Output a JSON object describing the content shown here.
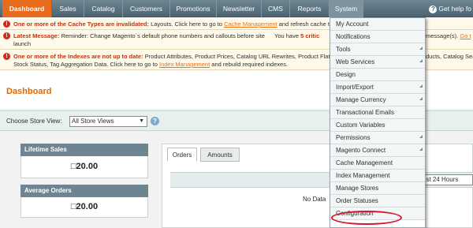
{
  "nav": {
    "items": [
      "Dashboard",
      "Sales",
      "Catalog",
      "Customers",
      "Promotions",
      "Newsletter",
      "CMS",
      "Reports",
      "System"
    ],
    "help_link": "Get help fo"
  },
  "messages": {
    "cache": {
      "lead": "One or more of the Cache Types are invalidated:",
      "text": "Layouts. Click here to go to",
      "link": "Cache Management",
      "tail": "and refresh cache t"
    },
    "latest": {
      "lead": "Latest Message:",
      "text": "Reminder: Change Magento`s default phone numbers and callouts before site",
      "text2": "launch",
      "right_prefix": "You have",
      "critical": "5 critic",
      "right_suffix": "message(s).",
      "right_link": "Go t"
    },
    "index": {
      "lead": "One or more of the Indexes are not up to date:",
      "text": "Product Attributes, Product Prices, Catalog URL Rewrites, Product Flat",
      "right_text": "ducts, Catalog Sea",
      "text2_start": "Stock Status, Tag Aggregation Data. Click here to go to",
      "link": "Index Management",
      "text2_end": "and rebuild required indexes."
    }
  },
  "page_title": "Dashboard",
  "store_switcher": {
    "label": "Choose Store View:",
    "value": "All Store Views"
  },
  "stats": {
    "lifetime_sales": {
      "label": "Lifetime Sales",
      "value": "□20.00"
    },
    "average_orders": {
      "label": "Average Orders",
      "value": "□20.00"
    }
  },
  "tabs": [
    "Orders",
    "Amounts"
  ],
  "period_select": "ast 24 Hours",
  "no_data": "No Data",
  "system_menu": {
    "items": [
      {
        "label": "My Account",
        "submenu": false
      },
      {
        "label": "Notifications",
        "submenu": false
      },
      {
        "label": "Tools",
        "submenu": true
      },
      {
        "label": "Web Services",
        "submenu": true
      },
      {
        "label": "Design",
        "submenu": false
      },
      {
        "label": "Import/Export",
        "submenu": true
      },
      {
        "label": "Manage Currency",
        "submenu": true
      },
      {
        "label": "Transactional Emails",
        "submenu": false
      },
      {
        "label": "Custom Variables",
        "submenu": false
      },
      {
        "label": "Permissions",
        "submenu": true
      },
      {
        "label": "Magento Connect",
        "submenu": true
      },
      {
        "label": "Cache Management",
        "submenu": false
      },
      {
        "label": "Index Management",
        "submenu": false
      },
      {
        "label": "Manage Stores",
        "submenu": false
      },
      {
        "label": "Order Statuses",
        "submenu": false
      },
      {
        "label": "Configuration",
        "submenu": false
      }
    ]
  },
  "colors": {
    "active_tab": "#e76b1a",
    "title": "#e26703",
    "highlight_oval": "#d8152b"
  }
}
